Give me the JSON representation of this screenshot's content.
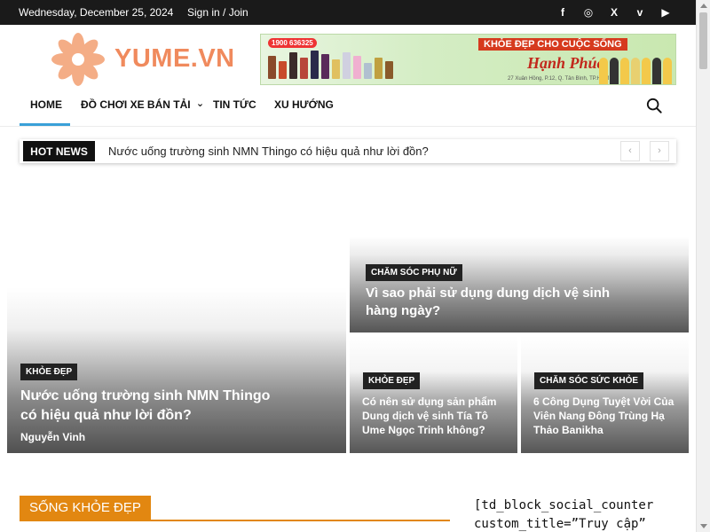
{
  "topbar": {
    "date": "Wednesday, December 25, 2024",
    "signin": "Sign in / Join",
    "social": [
      "f",
      "◎",
      "X",
      "v",
      "▶"
    ]
  },
  "logo": {
    "text": "YUME.VN",
    "color": "#f08a5d"
  },
  "banner": {
    "phone": "1900 636325",
    "slogan": "KHỎE ĐẸP CHO CUỘC SỐNG",
    "brand": "Hạnh Phúc",
    "address": "27 Xuân Hồng, P.12, Q. Tân Bình, TP.HCM"
  },
  "nav": {
    "items": [
      "HOME",
      "ĐỒ CHƠI XE BÁN TẢI",
      "TIN TỨC",
      "XU HƯỚNG"
    ],
    "dropdown_marker": "⌄",
    "accent": "#3aa0d8"
  },
  "hotnews": {
    "label": "HOT NEWS",
    "headline": "Nước uống trường sinh NMN Thingo có hiệu quả như lời đồn?",
    "prev": "‹",
    "next": "›"
  },
  "featured": {
    "main": {
      "category": "KHỎE ĐẸP",
      "title": "Nước uống trường sinh NMN Thingo có hiệu quả như lời đồn?",
      "author": "Nguyễn Vinh"
    },
    "top_right": {
      "category": "CHĂM SÓC PHỤ NỮ",
      "title": "Vì sao phải sử dụng dung dịch vệ sinh hàng ngày?"
    },
    "bottom_left": {
      "category": "KHỎE ĐẸP",
      "title": "Có nên sử dụng sản phẩm Dung dịch vệ sinh Tía Tô Ume Ngọc Trinh không?"
    },
    "bottom_right": {
      "category": "CHĂM SÓC SỨC KHỎE",
      "title": "6 Công Dụng Tuyệt Vời Của Viên Nang Đông Trùng Hạ Thảo Banikha"
    }
  },
  "section": {
    "title": "SỐNG KHỎE ĐẸP",
    "accent": "#e28711"
  },
  "sidebar": {
    "shortcode_line1": "[td_block_social_counter",
    "shortcode_line2": "custom_title=”Truy cập”"
  }
}
